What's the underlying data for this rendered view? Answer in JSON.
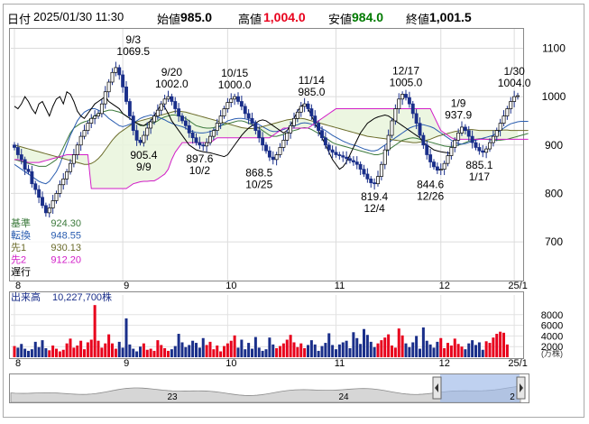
{
  "header": {
    "date_label": "日付",
    "datetime": "2025/01/30 11:30",
    "open_label": "始値",
    "open_value": "985.0",
    "high_label": "高値",
    "high_value": "1,004.0",
    "low_label": "安値",
    "low_value": "984.0",
    "close_label": "終値",
    "close_value": "1,001.5",
    "colors": {
      "high": "#e8001c",
      "low": "#007a00"
    }
  },
  "legend": [
    {
      "label": "基準",
      "value": "924.30",
      "color": "#3c7a3c"
    },
    {
      "label": "転換",
      "value": "948.55",
      "color": "#2a5db0"
    },
    {
      "label": "先1",
      "value": "930.13",
      "color": "#6b6b2a"
    },
    {
      "label": "先2",
      "value": "912.20",
      "color": "#d21ec8"
    },
    {
      "label": "遅行",
      "value": "",
      "color": "#000000"
    }
  ],
  "volume_label": "出来高",
  "volume_value": "10,227,700株",
  "volume_unit": "(万株)",
  "navigator_labels": [
    "23",
    "24",
    "2"
  ],
  "chart_data": [
    {
      "type": "candlestick",
      "title": "",
      "ylim": [
        620,
        1140
      ],
      "y_ticks": [
        "1100",
        "1000",
        "900",
        "800",
        "700"
      ],
      "x_tick_labels": [
        "8",
        "9",
        "10",
        "11",
        "12",
        "25/1"
      ],
      "annotations": [
        {
          "date": "9/3",
          "value": "1069.5",
          "kind": "high"
        },
        {
          "date": "9/9",
          "value": "905.4",
          "kind": "low"
        },
        {
          "date": "9/20",
          "value": "1002.0",
          "kind": "high"
        },
        {
          "date": "10/2",
          "value": "897.6",
          "kind": "low"
        },
        {
          "date": "10/15",
          "value": "1000.0",
          "kind": "high"
        },
        {
          "date": "10/25",
          "value": "868.5",
          "kind": "low"
        },
        {
          "date": "11/14",
          "value": "985.0",
          "kind": "high"
        },
        {
          "date": "12/4",
          "value": "819.4",
          "kind": "low"
        },
        {
          "date": "12/17",
          "value": "1005.0",
          "kind": "high"
        },
        {
          "date": "12/26",
          "value": "844.6",
          "kind": "low"
        },
        {
          "date": "1/9",
          "value": "937.9",
          "kind": "high"
        },
        {
          "date": "1/17",
          "value": "885.1",
          "kind": "low"
        },
        {
          "date": "1/30",
          "value": "1004.0",
          "kind": "high"
        }
      ],
      "colors": {
        "up": "#ffffff",
        "down": "#1a2f8a",
        "up_border": "#000000"
      },
      "closes": [
        895,
        880,
        870,
        850,
        845,
        820,
        808,
        792,
        775,
        760,
        770,
        785,
        800,
        818,
        830,
        845,
        862,
        880,
        900,
        918,
        930,
        945,
        955,
        960,
        965,
        985,
        1010,
        1030,
        1050,
        1060,
        1045,
        1020,
        990,
        960,
        930,
        910,
        905,
        920,
        935,
        948,
        960,
        972,
        985,
        995,
        1000,
        990,
        975,
        960,
        950,
        940,
        925,
        915,
        905,
        900,
        898,
        905,
        918,
        930,
        945,
        960,
        975,
        988,
        995,
        1000,
        990,
        980,
        965,
        955,
        945,
        930,
        915,
        900,
        888,
        875,
        870,
        880,
        895,
        910,
        925,
        940,
        955,
        968,
        980,
        985,
        975,
        960,
        945,
        930,
        915,
        900,
        890,
        885,
        880,
        878,
        875,
        872,
        868,
        865,
        860,
        850,
        840,
        830,
        822,
        820,
        835,
        860,
        890,
        920,
        950,
        975,
        995,
        1005,
        998,
        985,
        965,
        945,
        920,
        900,
        880,
        865,
        855,
        848,
        850,
        862,
        878,
        895,
        910,
        925,
        937,
        930,
        918,
        905,
        895,
        888,
        885,
        892,
        905,
        918,
        930,
        945,
        960,
        975,
        990,
        1000,
        1002
      ]
    },
    {
      "type": "line",
      "title": "",
      "series": [
        {
          "name": "基準",
          "color": "#3c7a3c",
          "values": [
            870,
            868,
            866,
            864,
            862,
            860,
            858,
            856,
            856,
            856,
            860,
            865,
            870,
            880,
            895,
            910,
            925,
            935,
            940,
            945,
            948,
            950,
            955,
            960,
            965,
            968,
            970,
            972,
            972,
            970,
            968,
            965,
            960,
            955,
            950,
            945,
            940,
            940,
            942,
            944,
            946,
            950,
            955,
            958,
            960,
            962,
            962,
            960,
            958,
            955,
            950,
            945,
            940,
            938,
            936,
            935,
            935,
            936,
            938,
            940,
            942,
            944,
            946,
            948,
            950,
            950,
            948,
            945,
            942,
            938,
            935,
            930,
            925,
            920,
            918,
            918,
            920,
            922,
            925,
            928,
            930,
            932,
            935,
            936,
            935,
            932,
            928,
            924,
            920,
            915,
            910,
            905,
            902,
            900,
            898,
            896,
            894,
            892,
            890,
            888,
            886,
            884,
            882,
            880,
            880,
            882,
            885,
            890,
            895,
            900,
            905,
            910,
            912,
            914,
            915,
            914,
            912,
            910,
            908,
            906,
            904,
            902,
            900,
            898,
            897,
            897,
            898,
            900,
            902,
            905,
            908,
            910,
            912,
            913,
            913,
            912,
            911,
            910,
            910,
            910,
            911,
            912,
            914,
            916,
            918,
            920,
            922,
            924
          ]
        },
        {
          "name": "転換",
          "color": "#2a5db0",
          "values": [
            860,
            855,
            850,
            845,
            840,
            835,
            830,
            825,
            822,
            820,
            825,
            835,
            845,
            860,
            880,
            900,
            920,
            935,
            950,
            960,
            968,
            972,
            975,
            975,
            972,
            968,
            962,
            955,
            950,
            945,
            940,
            938,
            940,
            943,
            946,
            950,
            955,
            958,
            960,
            962,
            960,
            958,
            955,
            952,
            948,
            945,
            942,
            940,
            938,
            935,
            930,
            928,
            926,
            925,
            925,
            926,
            928,
            930,
            935,
            940,
            945,
            950,
            952,
            954,
            955,
            955,
            954,
            952,
            950,
            946,
            942,
            938,
            934,
            930,
            928,
            928,
            930,
            932,
            935,
            938,
            940,
            942,
            945,
            946,
            945,
            943,
            940,
            937,
            934,
            930,
            925,
            920,
            916,
            912,
            908,
            905,
            902,
            900,
            898,
            895,
            892,
            890,
            888,
            888,
            890,
            895,
            900,
            905,
            910,
            915,
            920,
            925,
            930,
            935,
            938,
            940,
            942,
            942,
            940,
            938,
            935,
            930,
            925,
            920,
            915,
            910,
            906,
            903,
            902,
            903,
            905,
            908,
            910,
            912,
            914,
            916,
            918,
            920,
            925,
            930,
            935,
            940,
            944,
            946,
            948,
            949,
            949,
            949
          ]
        },
        {
          "name": "先1",
          "color": "#6b6b2a",
          "values": [
            900,
            898,
            896,
            894,
            892,
            890,
            888,
            886,
            884,
            882,
            880,
            878,
            876,
            874,
            872,
            870,
            868,
            866,
            864,
            862,
            860,
            860,
            862,
            866,
            872,
            880,
            890,
            900,
            910,
            918,
            925,
            930,
            935,
            940,
            945,
            948,
            950,
            952,
            954,
            956,
            958,
            960,
            962,
            964,
            966,
            968,
            970,
            970,
            969,
            968,
            966,
            964,
            962,
            960,
            958,
            956,
            954,
            952,
            950,
            948,
            946,
            944,
            942,
            940,
            938,
            936,
            935,
            934,
            934,
            935,
            936,
            938,
            940,
            942,
            944,
            946,
            948,
            950,
            952,
            953,
            954,
            955,
            955,
            954,
            952,
            950,
            948,
            946,
            944,
            942,
            940,
            938,
            936,
            934,
            932,
            930,
            928,
            926,
            924,
            922,
            920,
            918,
            917,
            916,
            915,
            914,
            913,
            912,
            911,
            910,
            909,
            908,
            907,
            906,
            905,
            905,
            906,
            908,
            910,
            912,
            915,
            918,
            920,
            922,
            924,
            926,
            928,
            929,
            930,
            931,
            932,
            932,
            931,
            930,
            930,
            930,
            930,
            930,
            930,
            931,
            931,
            931,
            930,
            930,
            930,
            930,
            930,
            930
          ]
        },
        {
          "name": "先2",
          "color": "#d21ec8",
          "values": [
            870,
            870,
            868,
            866,
            864,
            864,
            864,
            864,
            866,
            868,
            870,
            872,
            874,
            876,
            878,
            880,
            880,
            880,
            880,
            880,
            880,
            880,
            810,
            810,
            810,
            810,
            810,
            810,
            810,
            810,
            810,
            810,
            810,
            815,
            820,
            822,
            824,
            825,
            825,
            826,
            826,
            830,
            835,
            840,
            850,
            870,
            885,
            895,
            905,
            905,
            905,
            905,
            905,
            905,
            905,
            905,
            905,
            910,
            915,
            915,
            915,
            915,
            915,
            915,
            915,
            915,
            915,
            915,
            915,
            915,
            915,
            915,
            915,
            915,
            920,
            925,
            930,
            935,
            935,
            935,
            935,
            935,
            935,
            935,
            935,
            940,
            945,
            950,
            955,
            960,
            965,
            970,
            975,
            975,
            975,
            975,
            975,
            975,
            975,
            975,
            975,
            975,
            975,
            975,
            975,
            975,
            975,
            975,
            975,
            975,
            975,
            975,
            975,
            975,
            975,
            975,
            975,
            975,
            975,
            975,
            960,
            945,
            930,
            925,
            920,
            915,
            912,
            912,
            912,
            912,
            912,
            912,
            912,
            912,
            912,
            912,
            912,
            912,
            912,
            912,
            912,
            912,
            912,
            912,
            912,
            912,
            912,
            912
          ]
        },
        {
          "name": "遅行",
          "color": "#000000",
          "values": [
            980,
            975,
            985,
            1000,
            990,
            975,
            965,
            985,
            990,
            975,
            960,
            980,
            995,
            1000,
            985,
            1010,
            1005,
            990,
            970,
            960,
            955,
            965,
            975,
            985,
            990,
            995,
            1000,
            990,
            985,
            980,
            975,
            965,
            960,
            955,
            950,
            945,
            942,
            940,
            945,
            950,
            960,
            972,
            985,
            978,
            965,
            950,
            940,
            930,
            920,
            910,
            900,
            895,
            890,
            888,
            886,
            885,
            884,
            882,
            880,
            878,
            876,
            880,
            890,
            900,
            910,
            920,
            928,
            935,
            940,
            945,
            950,
            952,
            950,
            945,
            940,
            935,
            930,
            925,
            930,
            940,
            955,
            970,
            980,
            985,
            975,
            960,
            945,
            930,
            915,
            900,
            885,
            870,
            860,
            850,
            855,
            865,
            880,
            895,
            910,
            925,
            935,
            945,
            950,
            955,
            958,
            960,
            962,
            960,
            955,
            950,
            945,
            940,
            935,
            930,
            925,
            920,
            915,
            905,
            900,
            895,
            890,
            888,
            886,
            885,
            884,
            882
          ]
        }
      ]
    },
    {
      "type": "bar",
      "title": "",
      "ylim": [
        0,
        10000
      ],
      "y_ticks": [
        "8000",
        "6000",
        "4000",
        "2000"
      ],
      "x_tick_labels": [
        "8",
        "9",
        "10",
        "11",
        "12",
        "25/1"
      ],
      "colors": {
        "up": "#e8001c",
        "down": "#1a2f8a"
      },
      "values": [
        2100,
        1800,
        2500,
        1600,
        1200,
        1500,
        2900,
        1900,
        3200,
        1700,
        1300,
        2200,
        1600,
        1100,
        1400,
        2600,
        3500,
        1800,
        2200,
        3100,
        1500,
        2800,
        3300,
        9800,
        3100,
        1800,
        2600,
        4300,
        2600,
        1600,
        2900,
        1800,
        7300,
        2400,
        1600,
        1100,
        2000,
        2600,
        1400,
        1600,
        1200,
        3200,
        2300,
        1700,
        1200,
        1500,
        2100,
        4400,
        2800,
        1900,
        2300,
        3100,
        2700,
        1800,
        3600,
        2300,
        2900,
        1500,
        2200,
        1100,
        2100,
        2600,
        3100,
        4100,
        1800,
        3300,
        1500,
        2700,
        1600,
        3800,
        1800,
        1200,
        1500,
        3700,
        2400,
        1700,
        2100,
        2600,
        3300,
        4200,
        2800,
        1900,
        2600,
        1700,
        2300,
        3200,
        2400,
        1200,
        2100,
        2700,
        4500,
        2300,
        1500,
        2400,
        2800,
        3100,
        1700,
        4700,
        3600,
        2500,
        5300,
        4200,
        2900,
        1900,
        2600,
        3200,
        3700,
        4300,
        2200,
        1800,
        5400,
        4100,
        2600,
        1900,
        2800,
        4000,
        1600,
        5600,
        3100,
        2400,
        1800,
        2900,
        3600,
        1700,
        2700,
        2200,
        3500,
        2500,
        2000,
        1500,
        2600,
        3200,
        2300,
        2800,
        1400,
        3000,
        2700,
        3700,
        4400,
        4800,
        4600,
        2400
      ]
    }
  ]
}
